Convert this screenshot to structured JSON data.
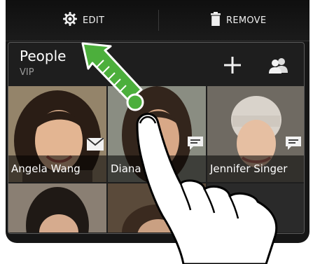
{
  "action_bar": {
    "edit_label": "EDIT",
    "remove_label": "REMOVE"
  },
  "widget": {
    "title": "People",
    "subtitle": "VIP"
  },
  "contacts": [
    {
      "name": "Angela Wang",
      "badge": "email-icon"
    },
    {
      "name": "Diana M",
      "badge": "chat-icon"
    },
    {
      "name": "Jennifer Singer",
      "badge": "chat-icon"
    }
  ],
  "colors": {
    "gesture_arrow": "#4caf3c",
    "action_bar": "#121212",
    "widget_bg": "#1e1e1e"
  }
}
